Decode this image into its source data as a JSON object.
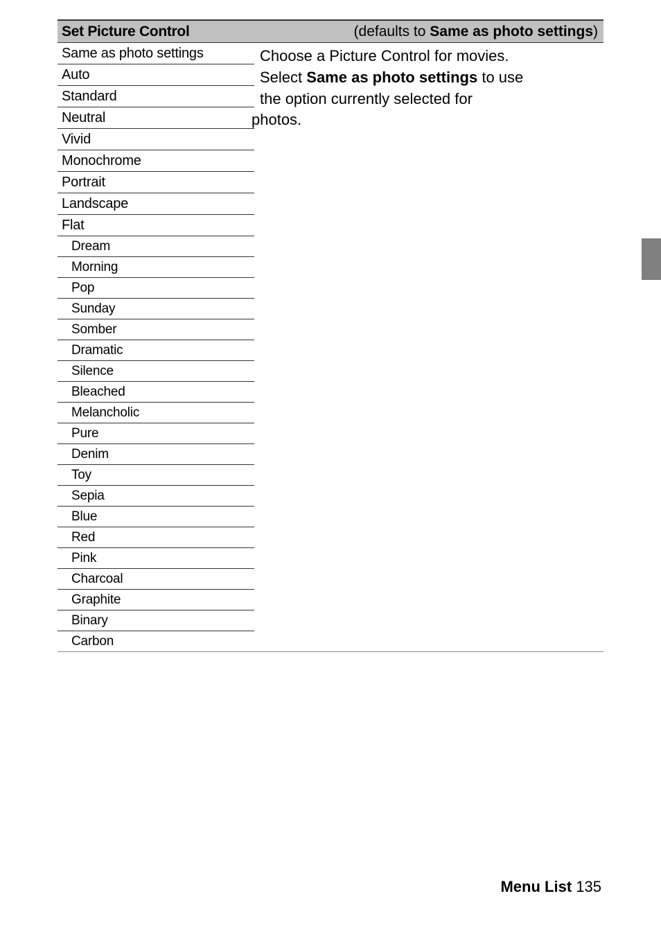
{
  "header": {
    "title": "Set Picture Control",
    "default_prefix": "(defaults to ",
    "default_value": "Same as photo settings",
    "default_suffix": ")"
  },
  "options": [
    {
      "label": "Same as photo settings",
      "indent": false
    },
    {
      "label": "Auto",
      "indent": false
    },
    {
      "label": "Standard",
      "indent": false
    },
    {
      "label": "Neutral",
      "indent": false
    },
    {
      "label": "Vivid",
      "indent": false
    },
    {
      "label": "Monochrome",
      "indent": false
    },
    {
      "label": "Portrait",
      "indent": false
    },
    {
      "label": "Landscape",
      "indent": false
    },
    {
      "label": "Flat",
      "indent": false
    },
    {
      "label": "Dream",
      "indent": true
    },
    {
      "label": "Morning",
      "indent": true
    },
    {
      "label": "Pop",
      "indent": true
    },
    {
      "label": "Sunday",
      "indent": true
    },
    {
      "label": "Somber",
      "indent": true
    },
    {
      "label": "Dramatic",
      "indent": true
    },
    {
      "label": "Silence",
      "indent": true
    },
    {
      "label": "Bleached",
      "indent": true
    },
    {
      "label": "Melancholic",
      "indent": true
    },
    {
      "label": "Pure",
      "indent": true
    },
    {
      "label": "Denim",
      "indent": true
    },
    {
      "label": "Toy",
      "indent": true
    },
    {
      "label": "Sepia",
      "indent": true
    },
    {
      "label": "Blue",
      "indent": true
    },
    {
      "label": "Red",
      "indent": true
    },
    {
      "label": "Pink",
      "indent": true
    },
    {
      "label": "Charcoal",
      "indent": true
    },
    {
      "label": "Graphite",
      "indent": true
    },
    {
      "label": "Binary",
      "indent": true
    },
    {
      "label": "Carbon",
      "indent": true
    }
  ],
  "description": {
    "line1": "Choose a Picture Control for movies. ",
    "line2a": "Select ",
    "line2b": "Same as photo settings",
    "line2c": " to use ",
    "line3": "the option currently selected for ",
    "line4": "photos."
  },
  "footer": {
    "section": "Menu List",
    "page": "135"
  }
}
